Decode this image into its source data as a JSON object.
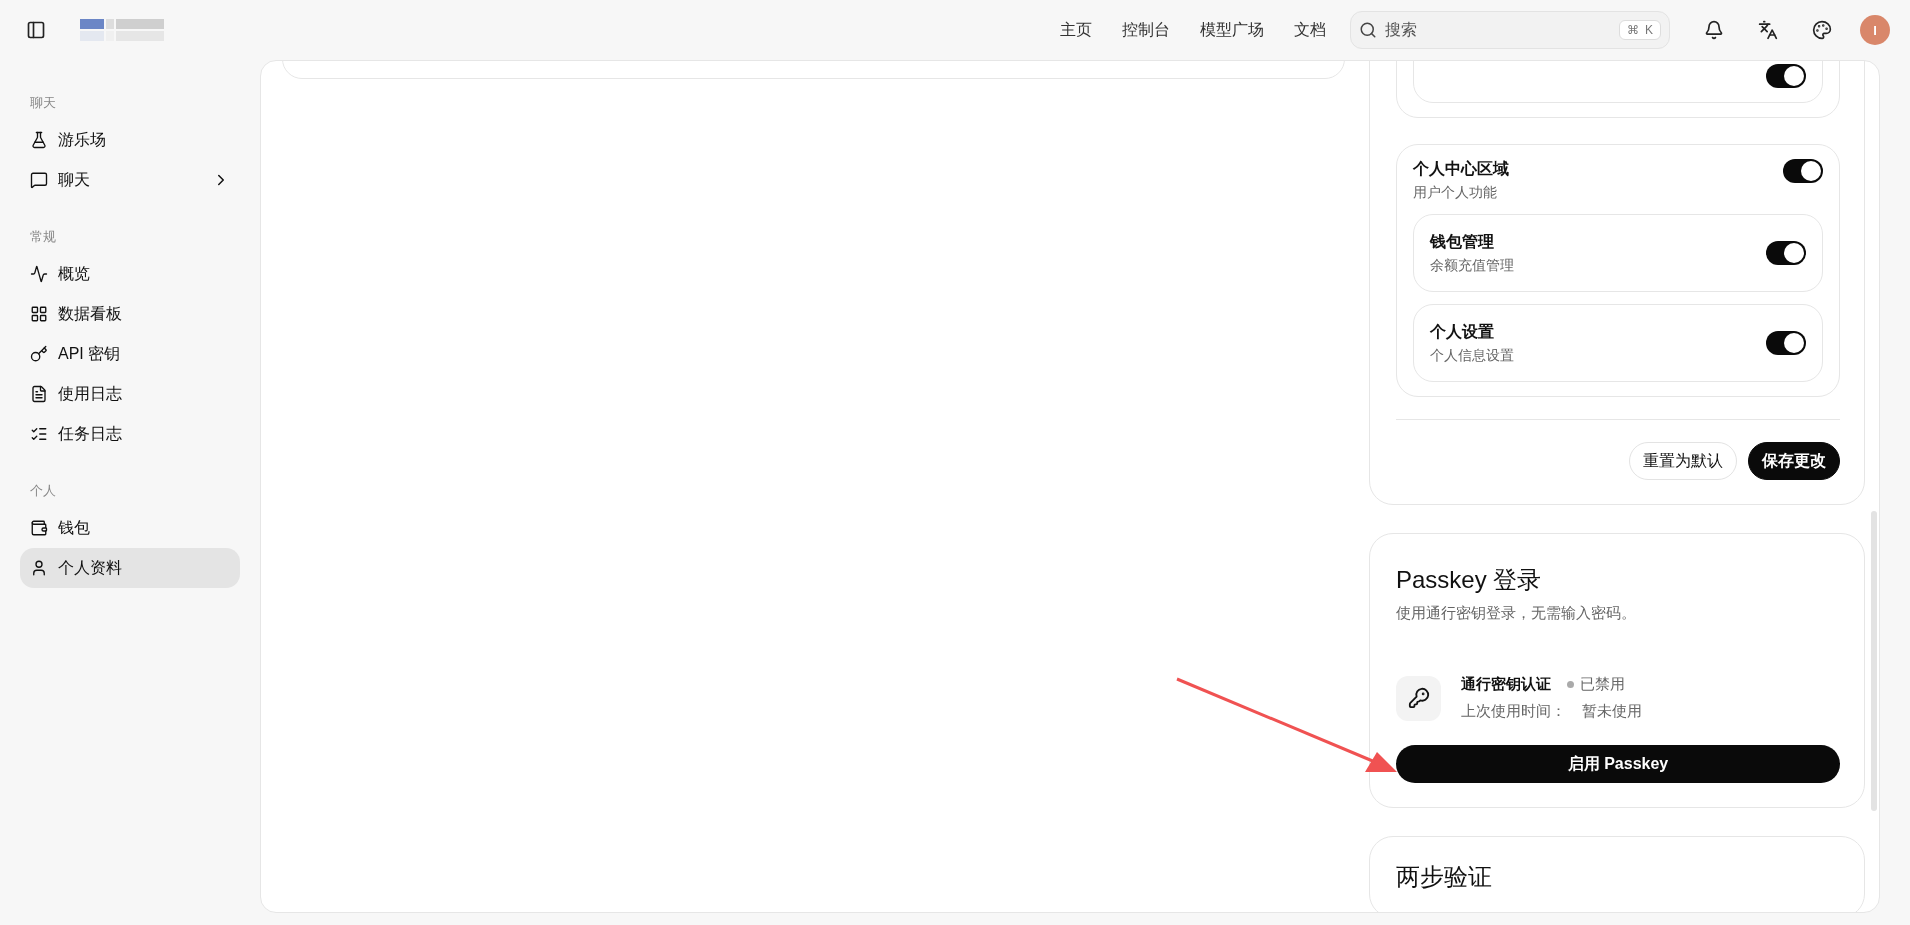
{
  "header": {
    "nav": [
      {
        "label": "主页"
      },
      {
        "label": "控制台"
      },
      {
        "label": "模型广场"
      },
      {
        "label": "文档"
      }
    ],
    "search": {
      "placeholder": "搜索",
      "shortcut": [
        "⌘",
        "K"
      ]
    },
    "avatar": {
      "initial": "I"
    }
  },
  "sidebar": {
    "sections": [
      {
        "title": "聊天",
        "items": [
          {
            "label": "游乐场",
            "expandable": false,
            "selected": false
          },
          {
            "label": "聊天",
            "expandable": true,
            "selected": false
          }
        ]
      },
      {
        "title": "常规",
        "items": [
          {
            "label": "概览",
            "expandable": false,
            "selected": false
          },
          {
            "label": "数据看板",
            "expandable": false,
            "selected": false
          },
          {
            "label": "API 密钥",
            "expandable": false,
            "selected": false
          },
          {
            "label": "使用日志",
            "expandable": false,
            "selected": false
          },
          {
            "label": "任务日志",
            "expandable": false,
            "selected": false
          }
        ]
      },
      {
        "title": "个人",
        "items": [
          {
            "label": "钱包",
            "expandable": false,
            "selected": false
          },
          {
            "label": "个人资料",
            "expandable": false,
            "selected": true
          }
        ]
      }
    ]
  },
  "module_settings": {
    "partial_group": {
      "on": true
    },
    "group": {
      "title": "个人中心区域",
      "description": "用户个人功能",
      "on": true,
      "items": [
        {
          "title": "钱包管理",
          "description": "余额充值管理",
          "on": true
        },
        {
          "title": "个人设置",
          "description": "个人信息设置",
          "on": true
        }
      ]
    },
    "actions": [
      {
        "label": "重置为默认",
        "kind": "secondary"
      },
      {
        "label": "保存更改",
        "kind": "primary"
      }
    ]
  },
  "passkey": {
    "title": "Passkey 登录",
    "description": "使用通行密钥登录，无需输入密码。",
    "credential": {
      "name": "通行密钥认证",
      "status": "已禁用",
      "enabled": false,
      "last_used_label": "上次使用时间：",
      "last_used_value": "暂未使用"
    },
    "button": "启用 Passkey"
  },
  "two_factor": {
    "title": "两步验证"
  }
}
